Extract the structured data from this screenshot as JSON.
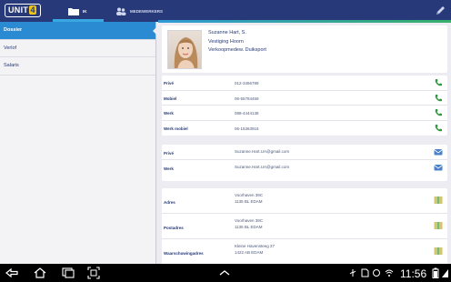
{
  "header": {
    "logo": {
      "text": "UNIT",
      "badge": "4"
    },
    "tabs": [
      {
        "label": "IK",
        "icon": "folder-icon",
        "active": true
      },
      {
        "label": "MEDEWERKERS",
        "icon": "people-icon",
        "active": false
      }
    ],
    "edit_icon": "pencil-icon"
  },
  "sidebar": {
    "items": [
      {
        "label": "Dossier",
        "active": true
      },
      {
        "label": "Verlof",
        "active": false
      },
      {
        "label": "Salaris",
        "active": false
      }
    ]
  },
  "profile": {
    "name": "Suzanne Hart, S.",
    "location": "Vestiging Hoorn",
    "role": "Verkoopmedew. Duiksport"
  },
  "phones": [
    {
      "label": "Privé",
      "value": "012-3456789",
      "icon": "phone-icon"
    },
    {
      "label": "Mobiel",
      "value": "06-55784459",
      "icon": "phone-icon"
    },
    {
      "label": "Werk",
      "value": "088-4444138",
      "icon": "phone-icon"
    },
    {
      "label": "Werk mobiel",
      "value": "06-15363916",
      "icon": "phone-icon"
    }
  ],
  "emails": [
    {
      "label": "Privé",
      "value": "Suzanne.Hart.UA@gmail.com",
      "icon": "mail-icon"
    },
    {
      "label": "Werk",
      "value": "Suzanne.Hart.UA@gmail.com",
      "icon": "mail-icon"
    }
  ],
  "addresses": [
    {
      "label": "Adres",
      "line1": "Voorhaven 39C",
      "line2": "1135 BL EDAM",
      "icon": "map-icon"
    },
    {
      "label": "Postadres",
      "line1": "Voorhaven 39C",
      "line2": "1135 BL EDAM",
      "icon": "map-icon"
    },
    {
      "label": "Waarschuwingadres",
      "line1": "Kleine Havensteeg 27",
      "line2": "1422 AB EDAM",
      "icon": "map-icon"
    }
  ],
  "statusbar": {
    "time": "11:56"
  },
  "colors": {
    "appbar": "#273978",
    "accent": "#2a8bd3",
    "text": "#273978",
    "phone": "#2e9a3e"
  }
}
